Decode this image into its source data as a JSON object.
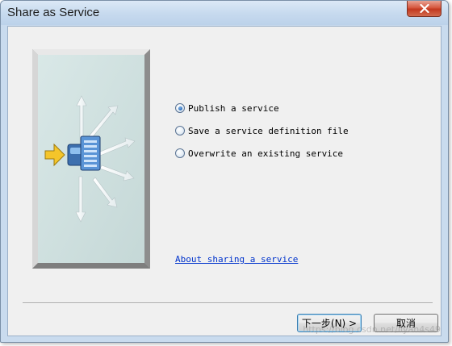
{
  "window": {
    "title": "Share as Service",
    "close_icon": "close-x-icon"
  },
  "illustration": {
    "icon": "publish-service-icon",
    "colors": {
      "panel": "#cfe0df",
      "arrow_in": "#f3c42a",
      "server": "#5a94d6"
    }
  },
  "options": [
    {
      "label": "Publish a service",
      "selected": true
    },
    {
      "label": "Save a service definition file",
      "selected": false
    },
    {
      "label": "Overwrite an existing service",
      "selected": false
    }
  ],
  "about_link": "About sharing a service",
  "buttons": {
    "next": "下一步(N) >",
    "cancel": "取消"
  },
  "watermark": "https://blog.csdn.net/liyan4s49"
}
